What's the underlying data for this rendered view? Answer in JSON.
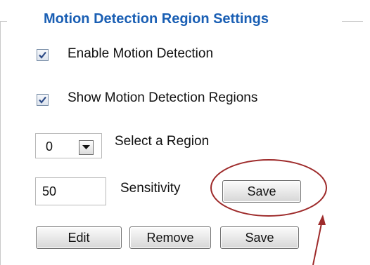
{
  "panel": {
    "legend": "Motion Detection Region Settings"
  },
  "options": {
    "enable_motion_detection": {
      "label": "Enable Motion Detection",
      "checked": true
    },
    "show_motion_detection_regions": {
      "label": "Show Motion Detection Regions",
      "checked": true
    }
  },
  "region_select": {
    "value": "0",
    "label": "Select a Region"
  },
  "sensitivity": {
    "value": "50",
    "label": "Sensitivity",
    "save_label": "Save"
  },
  "actions": {
    "edit_label": "Edit",
    "remove_label": "Remove",
    "save_label": "Save"
  },
  "annotation": {
    "color": "#9e2b2b"
  }
}
